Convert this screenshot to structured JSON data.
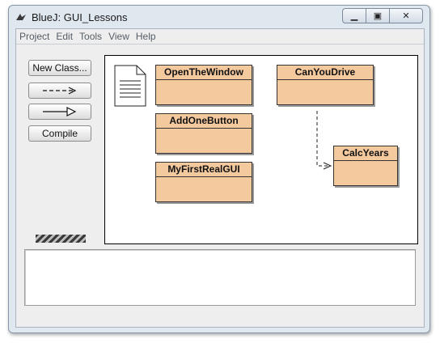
{
  "window": {
    "title": "BlueJ:  GUI_Lessons"
  },
  "menu": [
    "Project",
    "Edit",
    "Tools",
    "View",
    "Help"
  ],
  "toolbar": {
    "new_class": "New Class...",
    "dependency_arrow": "---->",
    "inheritance_arrow": "——▷",
    "compile": "Compile"
  },
  "classes": [
    {
      "name": "OpenTheWindow"
    },
    {
      "name": "CanYouDrive"
    },
    {
      "name": "AddOneButton"
    },
    {
      "name": "CalcYears"
    },
    {
      "name": "MyFirstRealGUI"
    }
  ],
  "colors": {
    "class_fill": "#f5c99e",
    "window_frame": "#dfe7ef"
  }
}
